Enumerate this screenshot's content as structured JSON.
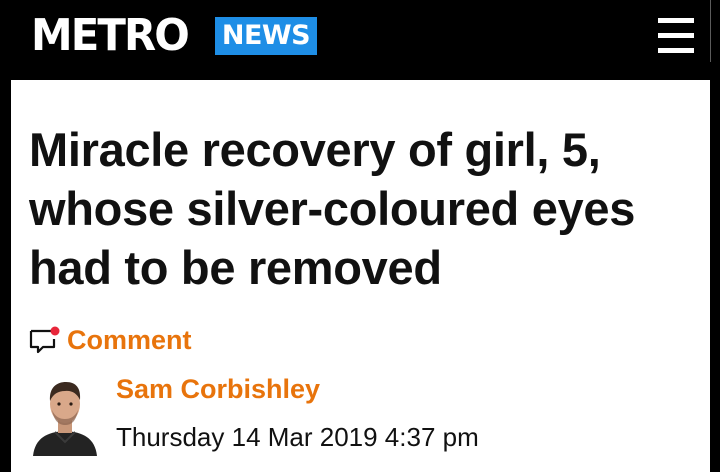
{
  "header": {
    "logo_text": "METRO",
    "section_label": "NEWS",
    "menu_icon": "hamburger-menu-icon"
  },
  "article": {
    "headline": "Miracle recovery of girl, 5, whose silver-coloured eyes had to be removed",
    "comment_label": "Comment",
    "comment_icon": "comment-bubble-icon",
    "author_name": "Sam Corbishley",
    "publish_date": "Thursday 14 Mar 2019 4:37 pm"
  },
  "colors": {
    "header_bg": "#000000",
    "section_badge": "#1e8ee6",
    "accent_orange": "#e8740c",
    "notification_dot": "#e8263a",
    "headline_text": "#111111"
  }
}
